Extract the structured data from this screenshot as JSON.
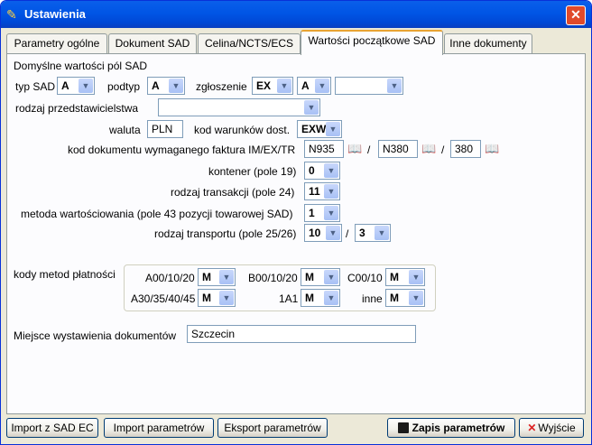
{
  "window": {
    "title": "Ustawienia"
  },
  "tabs": [
    "Parametry ogólne",
    "Dokument SAD",
    "Celina/NCTS/ECS",
    "Wartości początkowe SAD",
    "Inne dokumenty"
  ],
  "form": {
    "section_title": "Domyślne wartości pól SAD",
    "typ_sad": {
      "label": "typ SAD",
      "value": "A"
    },
    "podtyp": {
      "label": "podtyp",
      "value": "A"
    },
    "zgloszenie": {
      "label": "zgłoszenie",
      "value1": "EX",
      "value2": "A",
      "value3": ""
    },
    "rodzaj_przedstawicielstwa": {
      "label": "rodzaj przedstawicielstwa",
      "value": ""
    },
    "waluta": {
      "label": "waluta",
      "value": "PLN"
    },
    "kod_warunkow": {
      "label": "kod warunków dost.",
      "value": "EXW"
    },
    "kod_dokumentu": {
      "label": "kod dokumentu wymaganego faktura IM/EX/TR",
      "v1": "N935",
      "v2": "N380",
      "v3": "380",
      "sep": "/"
    },
    "kontener": {
      "label": "kontener (pole 19)",
      "value": "0"
    },
    "rodzaj_transakcji": {
      "label": "rodzaj transakcji (pole 24)",
      "value": "11"
    },
    "metoda": {
      "label": "metoda wartościowania (pole 43 pozycji towarowej SAD)",
      "value": "1"
    },
    "rodzaj_transportu": {
      "label": "rodzaj transportu (pole 25/26)",
      "value1": "10",
      "value2": "3",
      "sep": "/"
    },
    "kody_metod": {
      "label": "kody metod płatności",
      "items": [
        {
          "label": "A00/10/20",
          "value": "M"
        },
        {
          "label": "B00/10/20",
          "value": "M"
        },
        {
          "label": "C00/10",
          "value": "M"
        },
        {
          "label": "A30/35/40/45",
          "value": "M"
        },
        {
          "label": "1A1",
          "value": "M"
        },
        {
          "label": "inne",
          "value": "M"
        }
      ]
    },
    "miejsce": {
      "label": "Miejsce wystawienia dokumentów",
      "value": "Szczecin"
    }
  },
  "buttons": {
    "import_sad": "Import z SAD EC",
    "import_param": "Import parametrów",
    "eksport_param": "Eksport parametrów",
    "zapis": "Zapis parametrów",
    "wyjscie": "Wyjście"
  }
}
